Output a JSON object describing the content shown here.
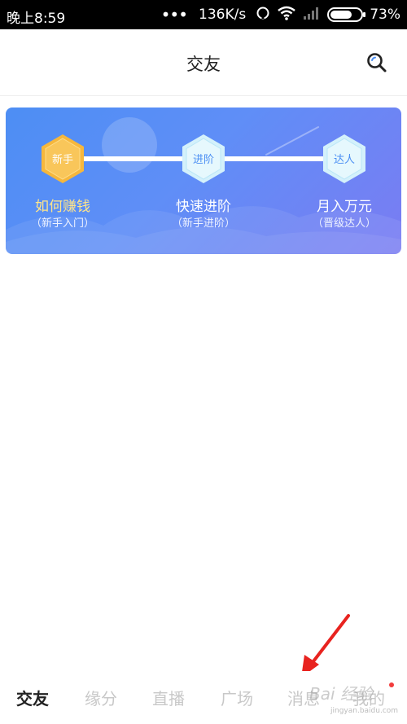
{
  "status_bar": {
    "time": "晚上8:59",
    "dots": "•••",
    "speed": "136K/s",
    "battery_percent": "73%",
    "battery_level": 0.73
  },
  "header": {
    "title": "交友",
    "search_icon": "search-icon"
  },
  "banner": {
    "steps": [
      {
        "badge": "新手",
        "title": "如何赚钱",
        "subtitle": "（新手入门）"
      },
      {
        "badge": "进阶",
        "title": "快速进阶",
        "subtitle": "（新手进阶）"
      },
      {
        "badge": "达人",
        "title": "月入万元",
        "subtitle": "（晋级达人）"
      }
    ],
    "colors": {
      "gradient_start": "#4d8ef4",
      "gradient_end": "#7a7cf2",
      "active_badge": "#f6b73c",
      "active_text": "#ffe58a"
    }
  },
  "bottom_nav": {
    "items": [
      {
        "label": "交友",
        "active": true
      },
      {
        "label": "缘分",
        "active": false
      },
      {
        "label": "直播",
        "active": false
      },
      {
        "label": "广场",
        "active": false
      },
      {
        "label": "消息",
        "active": false
      },
      {
        "label": "我的",
        "active": false
      }
    ]
  },
  "watermark": {
    "text": "Bai 经验",
    "sub": "jingyan.baidu.com"
  }
}
